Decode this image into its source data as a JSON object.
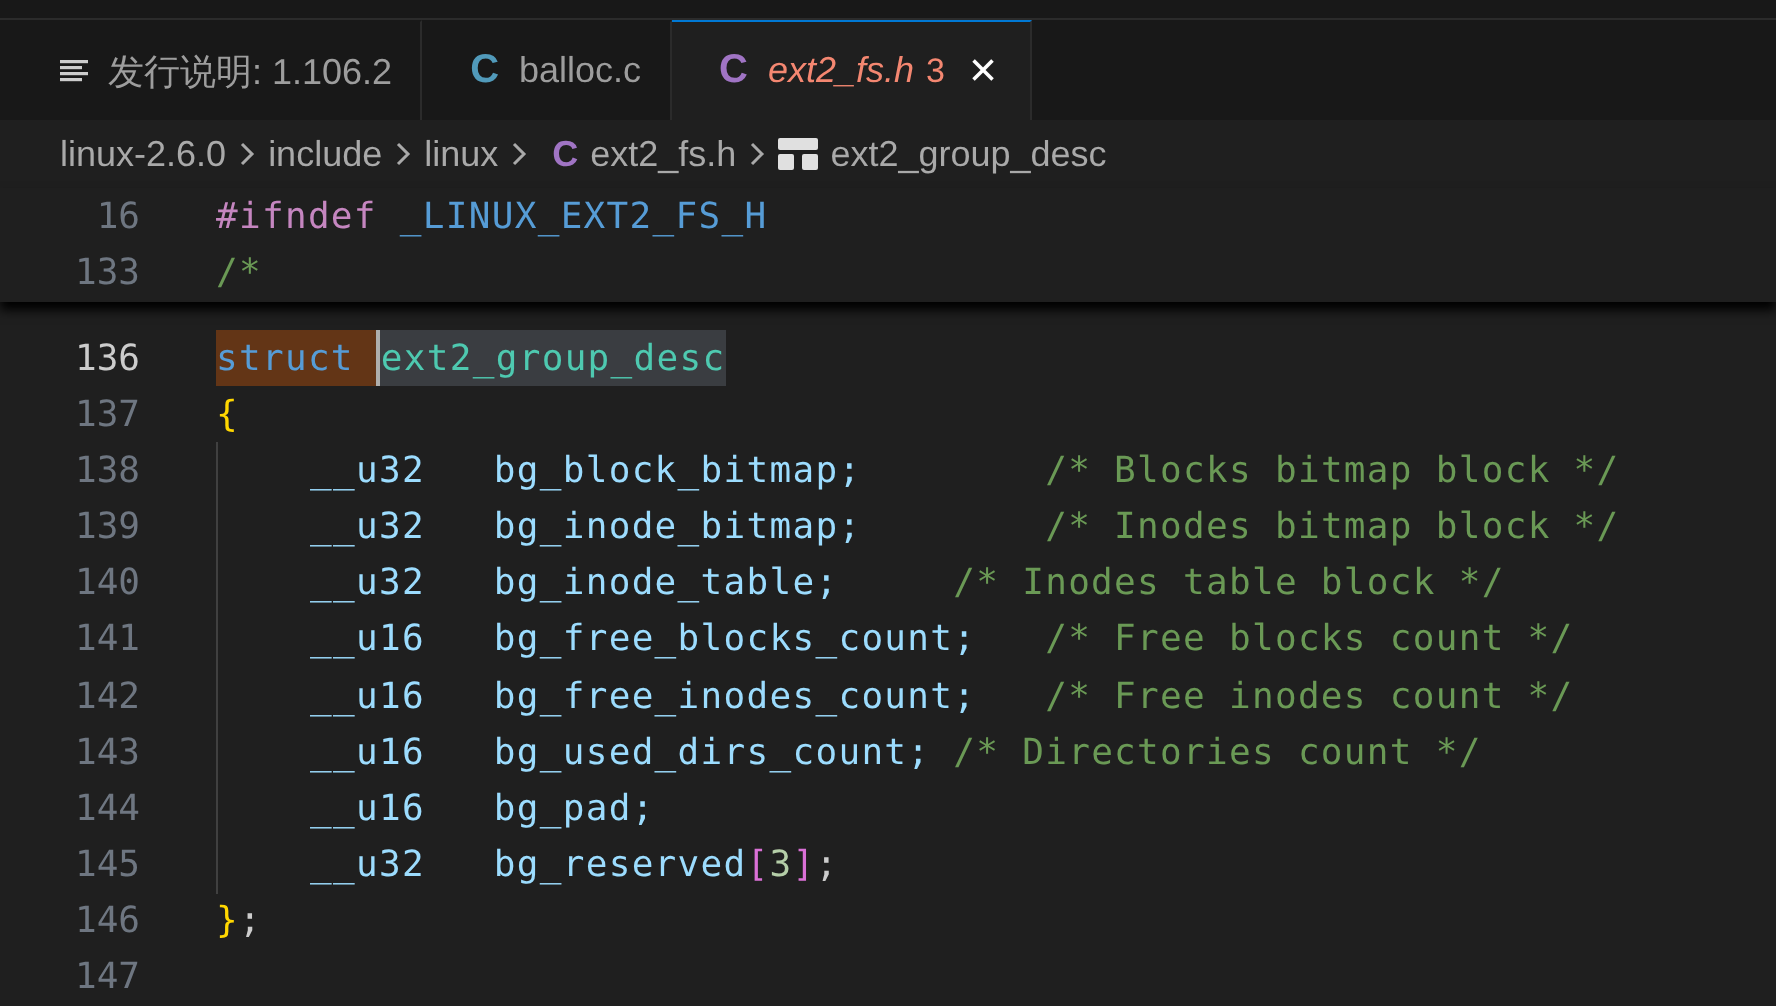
{
  "tabs": [
    {
      "kind": "preview",
      "label": "发行说明: 1.106.2",
      "selected": false,
      "preview": false
    },
    {
      "kind": "file",
      "letter": "C",
      "color": "#519aba",
      "label": "balloc.c",
      "selected": false,
      "preview": false
    },
    {
      "kind": "file",
      "letter": "C",
      "color": "#a074c4",
      "label": "ext2_fs.h",
      "problems": "3",
      "close": "×",
      "selected": true,
      "preview": true
    }
  ],
  "breadcrumbs": [
    {
      "kind": "folder",
      "label": "linux-2.6.0"
    },
    {
      "kind": "folder",
      "label": "include"
    },
    {
      "kind": "folder",
      "label": "linux"
    },
    {
      "kind": "file",
      "letter": "C",
      "label": "ext2_fs.h"
    },
    {
      "kind": "symbol",
      "label": "ext2_group_desc"
    }
  ],
  "sticky_lines": [
    {
      "number": "16",
      "tokens": [
        {
          "text": "#ifndef",
          "kind": "preprocessor"
        },
        {
          "text": " _LINUX_EXT2_FS_H",
          "kind": "macro"
        }
      ]
    },
    {
      "number": "133",
      "tokens": [
        {
          "text": "/*",
          "kind": "comment"
        }
      ]
    }
  ],
  "lines": [
    {
      "number": "136",
      "kind": "code",
      "current": true,
      "tokens": [
        {
          "text": "struct ",
          "kind": "type",
          "highlighted": true
        },
        {
          "text": "ext2_group_desc",
          "kind": "name",
          "highlighted": true
        }
      ]
    },
    {
      "number": "137",
      "kind": "code",
      "current": false,
      "tokens": [
        {
          "text": "{",
          "kind": "brace"
        }
      ]
    },
    {
      "number": "138",
      "kind": "member",
      "current": false,
      "tokens": [
        {
          "text": "__u32",
          "kind": "field"
        },
        {
          "text": "   bg_block_bitmap;",
          "kind": "field"
        },
        {
          "text": "        /* Blocks bitmap block */",
          "kind": "comment"
        }
      ]
    },
    {
      "number": "139",
      "kind": "member",
      "current": false,
      "tokens": [
        {
          "text": "__u32",
          "kind": "field"
        },
        {
          "text": "   bg_inode_bitmap;",
          "kind": "field"
        },
        {
          "text": "        /* Inodes bitmap block */",
          "kind": "comment"
        }
      ]
    },
    {
      "number": "140",
      "kind": "member",
      "current": false,
      "tokens": [
        {
          "text": "__u32",
          "kind": "field"
        },
        {
          "text": "   bg_inode_table;",
          "kind": "field"
        },
        {
          "text": "     /* Inodes table block */",
          "kind": "comment"
        }
      ]
    },
    {
      "number": "141",
      "kind": "member",
      "current": false,
      "tokens": [
        {
          "text": "__u16",
          "kind": "field"
        },
        {
          "text": "   bg_free_blocks_count;",
          "kind": "field"
        },
        {
          "text": "   /* Free blocks count */",
          "kind": "comment"
        }
      ]
    },
    {
      "number": "142",
      "kind": "member",
      "current": false,
      "tokens": [
        {
          "text": "__u16",
          "kind": "field"
        },
        {
          "text": "   bg_free_inodes_count;",
          "kind": "field"
        },
        {
          "text": "   /* Free inodes count */",
          "kind": "comment"
        }
      ]
    },
    {
      "number": "143",
      "kind": "member",
      "current": false,
      "tokens": [
        {
          "text": "__u16",
          "kind": "field"
        },
        {
          "text": "   bg_used_dirs_count;",
          "kind": "field"
        },
        {
          "text": " /* Directories count */",
          "kind": "comment"
        }
      ]
    },
    {
      "number": "144",
      "kind": "member",
      "current": false,
      "tokens": [
        {
          "text": "__u16",
          "kind": "field"
        },
        {
          "text": "   bg_pad;",
          "kind": "field"
        }
      ]
    },
    {
      "number": "145",
      "kind": "member",
      "current": false,
      "tokens": [
        {
          "text": "__u32",
          "kind": "field"
        },
        {
          "text": "   bg_reserved",
          "kind": "field"
        },
        {
          "text": "[",
          "kind": "bracket"
        },
        {
          "text": "3",
          "kind": "number"
        },
        {
          "text": "]",
          "kind": "bracket"
        },
        {
          "text": ";",
          "kind": "plain"
        }
      ]
    },
    {
      "number": "146",
      "kind": "code",
      "current": false,
      "tokens": [
        {
          "text": "}",
          "kind": "brace"
        },
        {
          "text": ";",
          "kind": "plain"
        }
      ]
    },
    {
      "number": "147",
      "kind": "code",
      "current": false
    }
  ]
}
